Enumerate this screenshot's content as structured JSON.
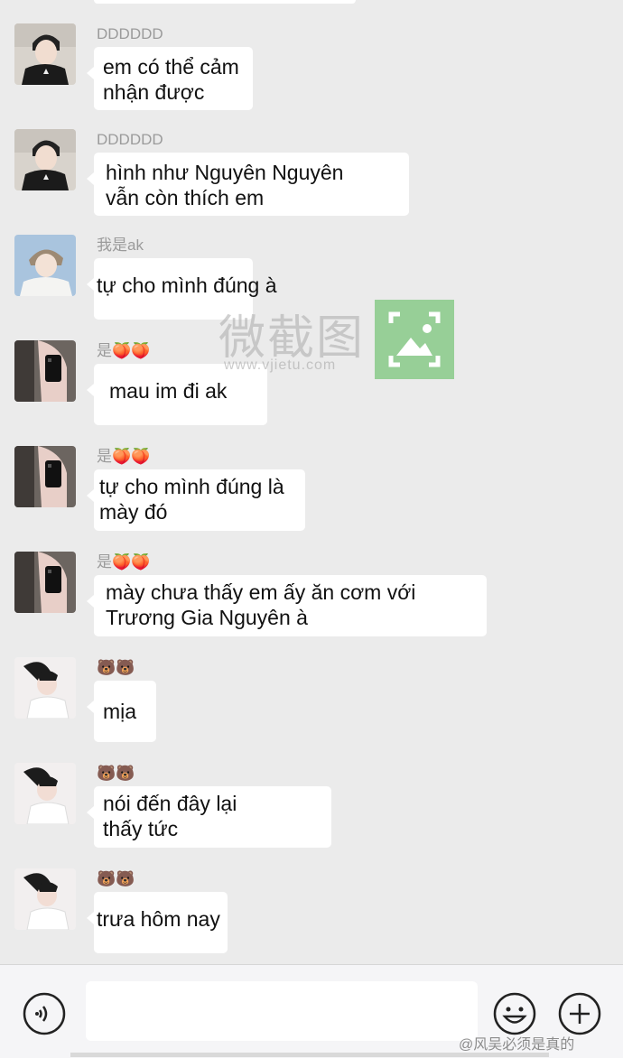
{
  "messages": [
    {
      "sender": "DDDDDD",
      "lines": [
        "em có thể cảm",
        "nhận được"
      ],
      "avatar": "avatar-boy-black-shirt"
    },
    {
      "sender": "DDDDDD",
      "lines": [
        "hình như Nguyên Nguyên",
        "vẫn còn thích em"
      ],
      "avatar": "avatar-boy-black-shirt"
    },
    {
      "sender": "我是ak",
      "lines": [
        "tự cho mình đúng à"
      ],
      "avatar": "avatar-boy-white-shirt"
    },
    {
      "sender": "是🍑🍑",
      "lines": [
        "mau im đi ak"
      ],
      "avatar": "avatar-mirror-selfie"
    },
    {
      "sender": "是🍑🍑",
      "lines": [
        "tự cho mình đúng là",
        "mày đó"
      ],
      "avatar": "avatar-mirror-selfie"
    },
    {
      "sender": "是🍑🍑",
      "lines": [
        "mày chưa thấy em ấy ăn cơm với",
        "Trương Gia Nguyên à"
      ],
      "avatar": "avatar-mirror-selfie"
    },
    {
      "sender": "🐻🐻",
      "lines": [
        "mịa"
      ],
      "avatar": "avatar-boy-pose"
    },
    {
      "sender": "🐻🐻",
      "lines": [
        "nói đến đây lại",
        "thấy tức"
      ],
      "avatar": "avatar-boy-pose"
    },
    {
      "sender": "🐻🐻",
      "lines": [
        "trưa hôm nay"
      ],
      "avatar": "avatar-boy-pose"
    }
  ],
  "watermark": {
    "text": "微截图",
    "url": "www.vjietu.com"
  },
  "footer_watermark": "@风吴必须是真的",
  "input_bar": {
    "voice_icon": "voice-icon",
    "emoji_icon": "emoji-icon",
    "plus_icon": "plus-icon",
    "input_value": ""
  },
  "colors": {
    "background": "#ebebeb",
    "bubble": "#ffffff",
    "sender_name": "#9b9b9b",
    "watermark_green": "#82c882"
  }
}
